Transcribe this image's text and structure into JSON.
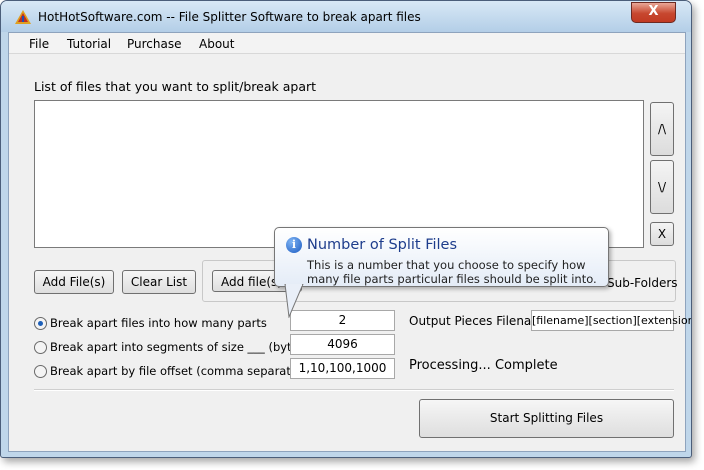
{
  "window": {
    "title": "HotHotSoftware.com -- File Splitter Software to break apart files",
    "close_glyph": "X"
  },
  "menu": [
    {
      "label": "File"
    },
    {
      "label": "Tutorial"
    },
    {
      "label": "Purchase"
    },
    {
      "label": "About"
    }
  ],
  "file_list": {
    "label": "List of files that you want to split/break apart"
  },
  "side_buttons": {
    "up": "/\\",
    "down": "\\/",
    "delete": "X"
  },
  "buttons": {
    "add_files": "Add File(s)",
    "clear_list": "Clear List",
    "add_folder": "Add file(s) b",
    "start": "Start Splitting Files"
  },
  "subfolders_label": "Sub-Folders",
  "options": [
    {
      "label": "Break apart files into how many parts",
      "value": "2",
      "checked": true
    },
    {
      "label": "Break apart into segments of size ___ (bytes)",
      "value": "4096",
      "checked": false
    },
    {
      "label": "Break apart by file offset (comma separated)",
      "value": "1,10,100,1000",
      "checked": false
    }
  ],
  "output": {
    "label": "Output Pieces Filename",
    "value": "[filename][section][extension]"
  },
  "status": "Processing... Complete",
  "tooltip": {
    "icon": "i",
    "title": "Number of Split Files",
    "body": "This is a number that you choose to specify how many file parts particular files should be split into."
  }
}
